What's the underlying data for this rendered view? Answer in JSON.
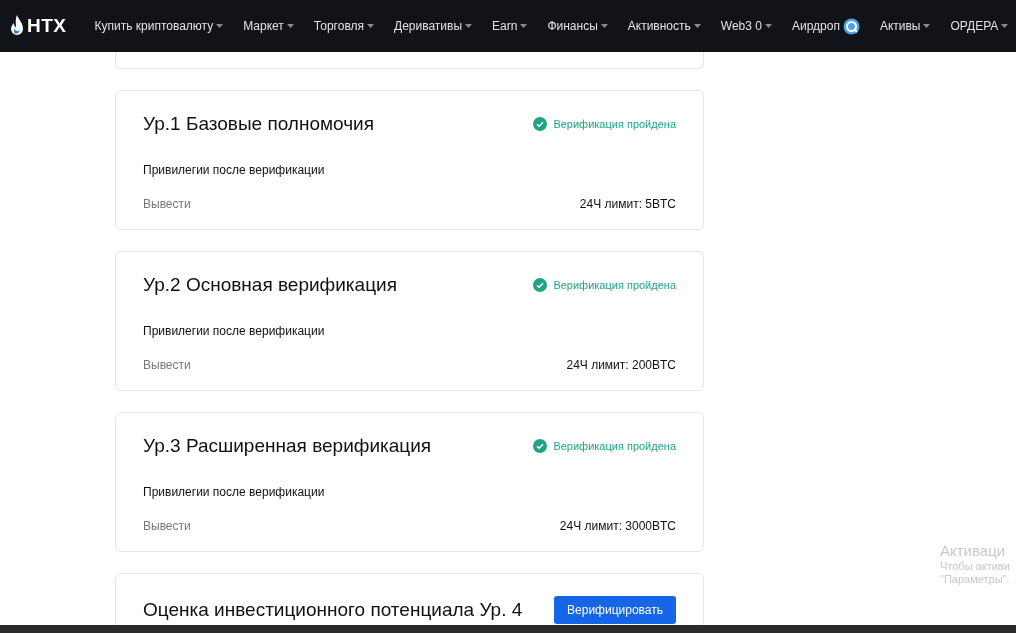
{
  "logo": "HTX",
  "nav": [
    {
      "label": "Купить криптовалюту",
      "kind": "dropdown"
    },
    {
      "label": "Маркет",
      "kind": "dropdown"
    },
    {
      "label": "Торговля",
      "kind": "dropdown"
    },
    {
      "label": "Деривативы",
      "kind": "dropdown"
    },
    {
      "label": "Earn",
      "kind": "dropdown"
    },
    {
      "label": "Финансы",
      "kind": "dropdown"
    },
    {
      "label": "Активность",
      "kind": "dropdown"
    },
    {
      "label": "Web3 0",
      "kind": "dropdown"
    },
    {
      "label": "Аирдроп",
      "kind": "badge"
    },
    {
      "label": "Активы",
      "kind": "dropdown"
    },
    {
      "label": "ОРДЕРА",
      "kind": "dropdown"
    }
  ],
  "levels": [
    {
      "title": "Ур.1 Базовые полномочия",
      "verified": true,
      "status": "Верификация пройдена",
      "privileges": "Привилегии после верификации",
      "row_label": "Вывести",
      "limit": "24Ч лимит: 5BTC"
    },
    {
      "title": "Ур.2 Основная верификация",
      "verified": true,
      "status": "Верификация пройдена",
      "privileges": "Привилегии после верификации",
      "row_label": "Вывести",
      "limit": "24Ч лимит: 200BTC"
    },
    {
      "title": "Ур.3 Расширенная верификация",
      "verified": true,
      "status": "Верификация пройдена",
      "privileges": "Привилегии после верификации",
      "row_label": "Вывести",
      "limit": "24Ч лимит: 3000BTC"
    },
    {
      "title": "Оценка инвестиционного потенциала Ур. 4",
      "verified": false,
      "action": "Верифицировать"
    }
  ],
  "activation_notice": {
    "title": "Активаци",
    "lines": [
      "Чтобы активи",
      "\"Параметры\"."
    ]
  }
}
